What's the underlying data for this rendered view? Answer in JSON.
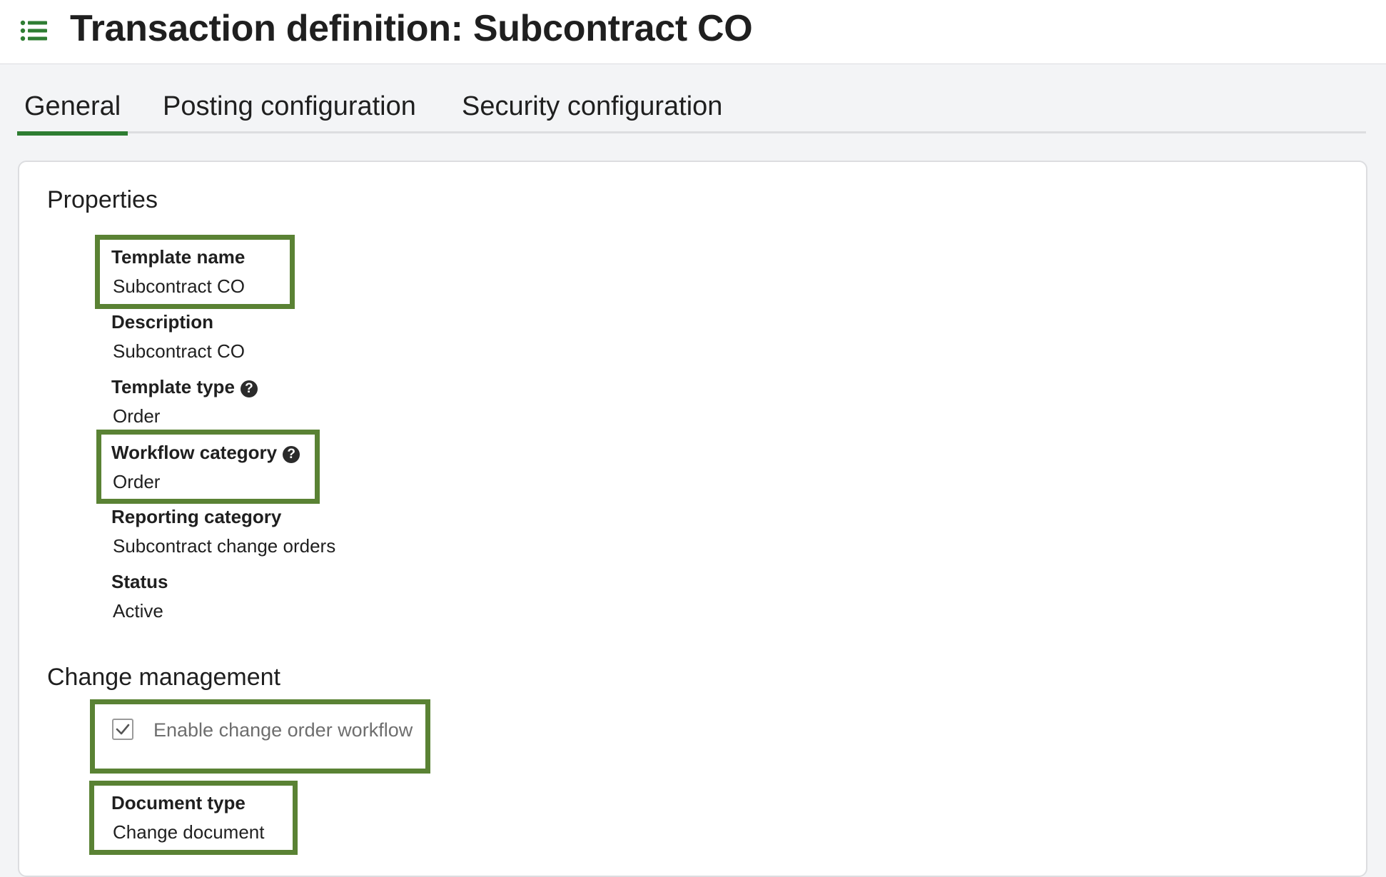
{
  "header": {
    "title": "Transaction definition: Subcontract CO",
    "menu_icon": "list-icon"
  },
  "tabs": [
    {
      "label": "General",
      "active": true
    },
    {
      "label": "Posting configuration",
      "active": false
    },
    {
      "label": "Security configuration",
      "active": false
    }
  ],
  "properties": {
    "heading": "Properties",
    "template_name": {
      "label": "Template name",
      "value": "Subcontract CO"
    },
    "description": {
      "label": "Description",
      "value": "Subcontract CO"
    },
    "template_type": {
      "label": "Template type",
      "value": "Order",
      "help_icon": "question-circle-icon"
    },
    "workflow_category": {
      "label": "Workflow category",
      "value": "Order",
      "help_icon": "question-circle-icon"
    },
    "reporting_category": {
      "label": "Reporting category",
      "value": "Subcontract change orders"
    },
    "status": {
      "label": "Status",
      "value": "Active"
    }
  },
  "change_management": {
    "heading": "Change management",
    "enable_workflow": {
      "label": "Enable change order workflow",
      "checked": true
    },
    "document_type": {
      "label": "Document type",
      "value": "Change document"
    }
  },
  "colors": {
    "accent": "#2e7d32",
    "highlight": "#5a8234",
    "background": "#f3f4f6"
  }
}
